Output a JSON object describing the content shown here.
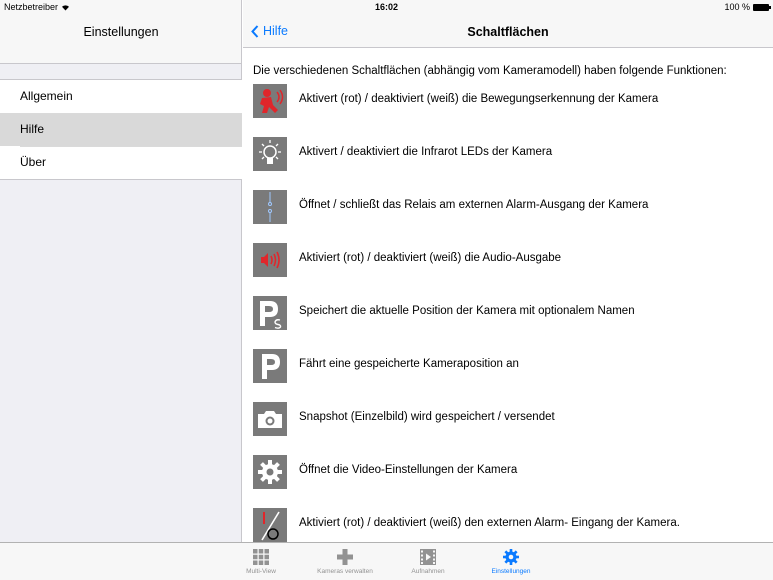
{
  "status_bar": {
    "carrier": "Netzbetreiber",
    "time": "16:02",
    "battery": "100 %"
  },
  "sidebar": {
    "title": "Einstellungen",
    "items": [
      {
        "label": "Allgemein",
        "selected": false
      },
      {
        "label": "Hilfe",
        "selected": true
      },
      {
        "label": "Über",
        "selected": false
      }
    ]
  },
  "detail": {
    "back_label": "Hilfe",
    "title": "Schaltflächen",
    "intro": "Die verschiedenen Schaltflächen (abhängig vom Kameramodell) haben folgende Funktionen:",
    "rows": [
      {
        "icon": "motion-detection-icon",
        "text": "Aktivert (rot) / deaktiviert (weiß) die Bewegungserkennung der Kamera"
      },
      {
        "icon": "infrared-led-icon",
        "text": "Aktivert / deaktiviert die Infrarot LEDs der Kamera"
      },
      {
        "icon": "relay-icon",
        "text": "Öffnet / schließt das Relais am externen Alarm-Ausgang der Kamera"
      },
      {
        "icon": "audio-output-icon",
        "text": "Aktiviert (rot) / deaktiviert (weiß) die Audio-Ausgabe"
      },
      {
        "icon": "save-position-icon",
        "text": "Speichert die aktuelle Position der Kamera mit optionalem Namen"
      },
      {
        "icon": "goto-position-icon",
        "text": "Fährt eine gespeicherte Kameraposition an"
      },
      {
        "icon": "snapshot-camera-icon",
        "text": "Snapshot (Einzelbild) wird gespeichert / versendet"
      },
      {
        "icon": "video-settings-gear-icon",
        "text": "Öffnet die Video-Einstellungen der Kamera"
      },
      {
        "icon": "alarm-input-icon",
        "text": "Aktiviert (rot) / deaktiviert (weiß) den externen Alarm- Eingang der Kamera."
      }
    ]
  },
  "tab_bar": {
    "tabs": [
      {
        "label": "Multi-View",
        "icon": "grid-icon",
        "active": false
      },
      {
        "label": "Kameras verwalten",
        "icon": "plus-icon",
        "active": false
      },
      {
        "label": "Aufnahmen",
        "icon": "film-icon",
        "active": false
      },
      {
        "label": "Einstellungen",
        "icon": "gear-icon",
        "active": true
      }
    ]
  },
  "colors": {
    "accent": "#0a7aff",
    "alert_red": "#e0262b",
    "icon_gray": "#7a7a7a"
  }
}
